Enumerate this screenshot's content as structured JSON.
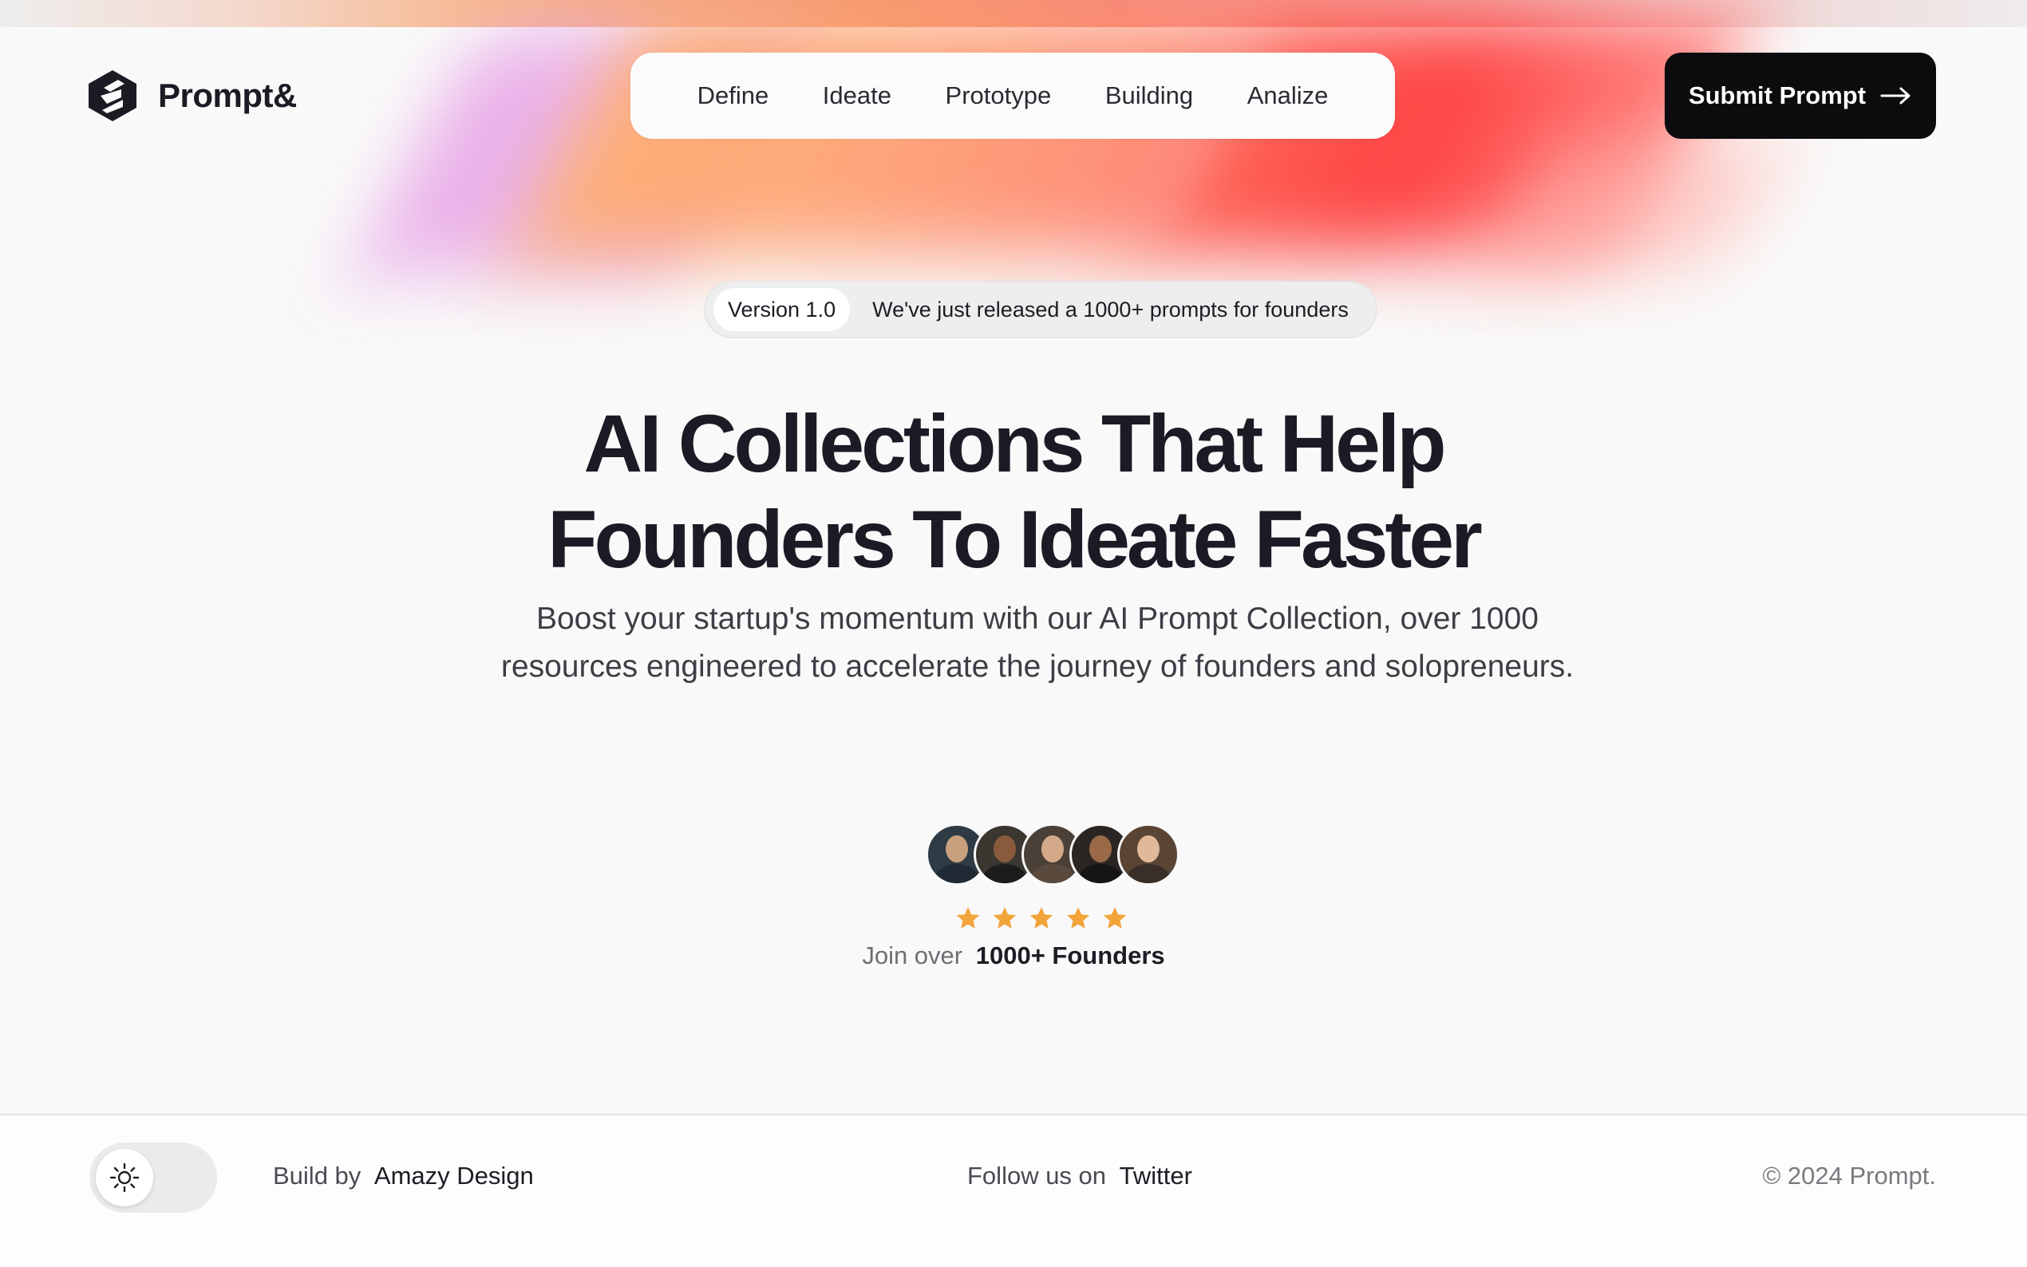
{
  "brand": {
    "name": "Prompt&",
    "logo_icon": "hexagon-s-logo-icon"
  },
  "nav": {
    "items": [
      {
        "label": "Define"
      },
      {
        "label": "Ideate"
      },
      {
        "label": "Prototype"
      },
      {
        "label": "Building"
      },
      {
        "label": "Analize"
      }
    ]
  },
  "cta": {
    "label": "Submit Prompt",
    "icon": "arrow-right-icon"
  },
  "announcement": {
    "badge": "Version 1.0",
    "text": "We've just released a 1000+ prompts for founders"
  },
  "hero": {
    "title_line1": "AI Collections That Help",
    "title_line2": "Founders To Ideate Faster",
    "description": "Boost your startup's momentum with our AI Prompt Collection, over 1000 resources engineered to accelerate the journey of founders and solopreneurs."
  },
  "social_proof": {
    "avatars": [
      "founder-avatar-1",
      "founder-avatar-2",
      "founder-avatar-3",
      "founder-avatar-4",
      "founder-avatar-5"
    ],
    "rating": 5,
    "join_label": "Join over",
    "join_count": "1000+ Founders"
  },
  "footer": {
    "theme_icon": "sun-icon",
    "built_label": "Build by",
    "built_name": "Amazy Design",
    "follow_label": "Follow us on",
    "follow_link": "Twitter",
    "copyright": "© 2024 Prompt."
  },
  "colors": {
    "background": "#f9f9f9",
    "text": "#1c1c24",
    "cta_bg": "#0c0c0e",
    "star": "#f2a33a",
    "gradient_pink": "#e8a6e6",
    "gradient_orange": "#ff9c6e",
    "gradient_red": "#ff3030"
  }
}
